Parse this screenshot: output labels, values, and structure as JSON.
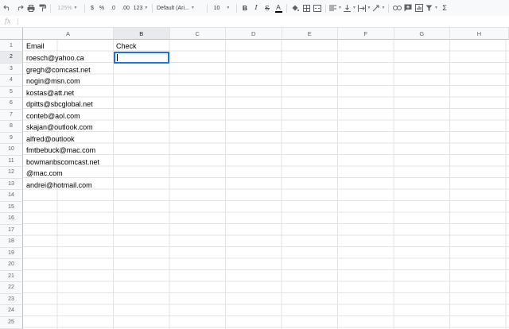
{
  "toolbar": {
    "zoom": "125%",
    "currency": "$",
    "percent": "%",
    "decrease_decimals": ".0",
    "increase_decimals": ".00",
    "more_formats": "123",
    "font_family": "Default (Ari...",
    "font_size": "10",
    "bold": "B",
    "italic": "I",
    "strikethrough": "S",
    "text_color": "A",
    "accent_color": "#1a73e8"
  },
  "formula_bar": {
    "label": "fx",
    "value": ""
  },
  "columns": [
    "A",
    "B",
    "C",
    "D",
    "E",
    "F",
    "G",
    "H"
  ],
  "rows": [
    "1",
    "2",
    "3",
    "4",
    "5",
    "6",
    "7",
    "8",
    "9",
    "10",
    "11",
    "12",
    "13",
    "14",
    "15",
    "16",
    "17",
    "18",
    "19",
    "20",
    "21",
    "22",
    "23",
    "24",
    "25"
  ],
  "selected_cell": "B2",
  "cells": {
    "A1": "Email",
    "B1": "Check",
    "A2": "roesch@yahoo.ca",
    "A3": "gregh@comcast.net",
    "A4": "nogin@msn.com",
    "A5": "kostas@att.net",
    "A6": "dpitts@sbcglobal.net",
    "A7": "conteb@aol.com",
    "A8": "skajan@outlook.com",
    "A9": "alfred@outlook",
    "A10": "fmtbebuck@mac.com",
    "A11": "bowmanbscomcast.net",
    "A12": "@mac.com",
    "A13": "andrei@hotmail.com"
  }
}
